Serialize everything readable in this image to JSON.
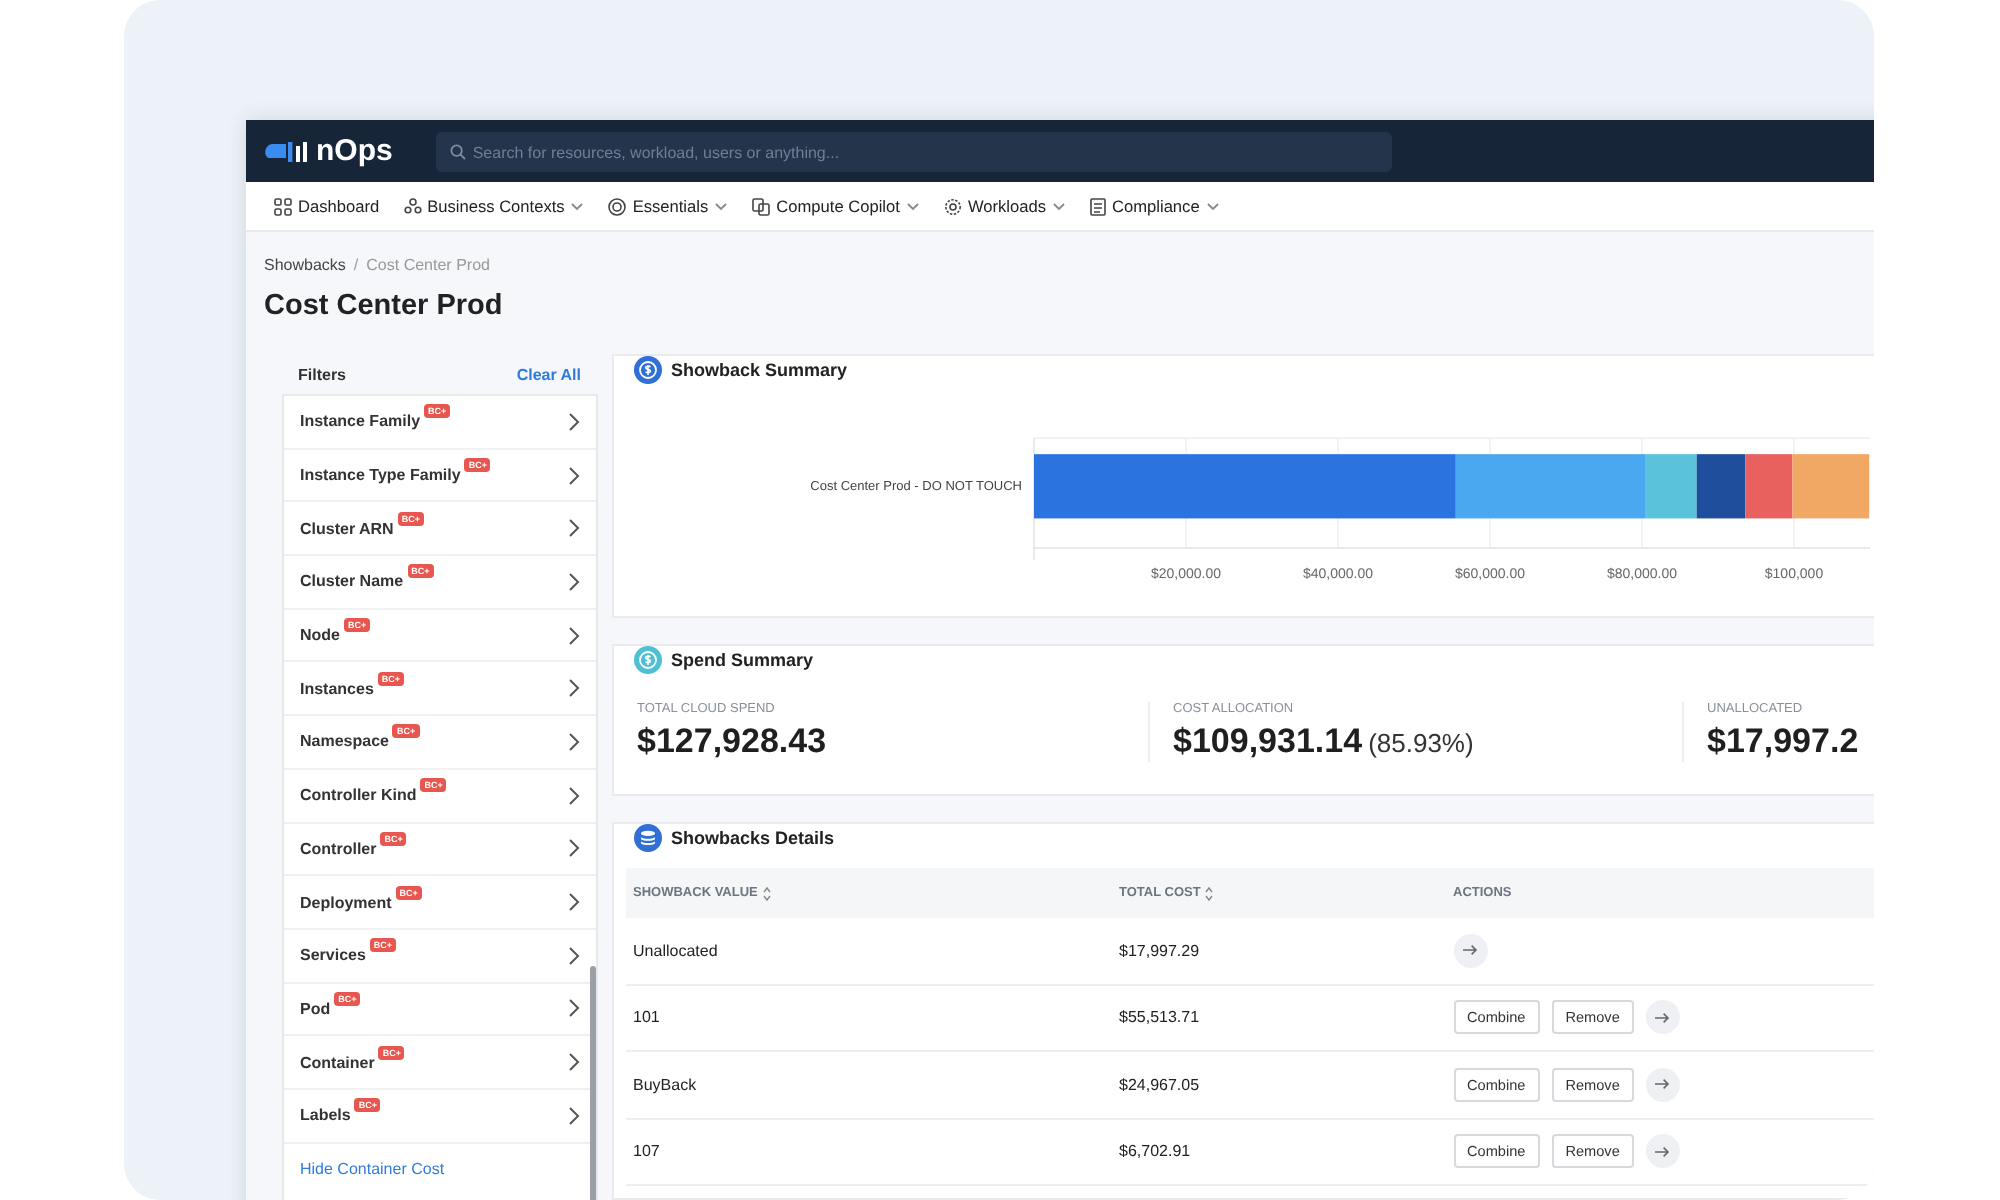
{
  "app": {
    "logo": "nOps",
    "search": {
      "placeholder": "Search for resources, workload, users or anything..."
    }
  },
  "menu": [
    {
      "label": "Dashboard",
      "dropdown": false
    },
    {
      "label": "Business Contexts",
      "dropdown": true
    },
    {
      "label": "Essentials",
      "dropdown": true
    },
    {
      "label": "Compute Copilot",
      "dropdown": true
    },
    {
      "label": "Workloads",
      "dropdown": true
    },
    {
      "label": "Compliance",
      "dropdown": true
    }
  ],
  "breadcrumb": [
    "Showbacks",
    "Cost Center Prod"
  ],
  "breadcrumb_separator": "/",
  "title": "Cost Center Prod",
  "filters": {
    "title": "Filters",
    "clear": "Clear All",
    "link": "Hide Container Cost",
    "items": [
      {
        "label": "Instance Family",
        "badge": "BC+"
      },
      {
        "label": "Instance Type Family",
        "badge": "BC+"
      },
      {
        "label": "Cluster ARN",
        "badge": "BC+"
      },
      {
        "label": "Cluster Name",
        "badge": "BC+"
      },
      {
        "label": "Node",
        "badge": "BC+"
      },
      {
        "label": "Instances",
        "badge": "BC+"
      },
      {
        "label": "Namespace",
        "badge": "BC+"
      },
      {
        "label": "Controller Kind",
        "badge": "BC+"
      },
      {
        "label": "Controller",
        "badge": "BC+"
      },
      {
        "label": "Deployment",
        "badge": "BC+"
      },
      {
        "label": "Services",
        "badge": "BC+"
      },
      {
        "label": "Pod",
        "badge": "BC+"
      },
      {
        "label": "Container",
        "badge": "BC+"
      },
      {
        "label": "Labels",
        "badge": "BC+"
      }
    ]
  },
  "showback_summary": {
    "title": "Showback Summary",
    "chart_data": {
      "type": "bar",
      "orientation": "horizontal",
      "stacked": true,
      "categories": [
        "Cost Center Prod - DO NOT TOUCH"
      ],
      "xlim": [
        0,
        110000
      ],
      "grid": true,
      "xticks": [
        {
          "value": 20000,
          "label": "$20,000.00"
        },
        {
          "value": 40000,
          "label": "$40,000.00"
        },
        {
          "value": 60000,
          "label": "$60,000.00"
        },
        {
          "value": 80000,
          "label": "$80,000.00"
        },
        {
          "value": 100000,
          "label": "$100,000"
        }
      ],
      "series": [
        {
          "color": "#2b74e0",
          "values": [
            55500
          ]
        },
        {
          "color": "#4aa8f0",
          "values": [
            25000
          ]
        },
        {
          "color": "#5bc2dc",
          "values": [
            6700
          ]
        },
        {
          "color": "#1f4f9c",
          "values": [
            6400
          ]
        },
        {
          "color": "#e8615f",
          "values": [
            6200
          ]
        },
        {
          "color": "#f2a865",
          "values": [
            10100
          ]
        }
      ]
    }
  },
  "spend_summary": {
    "title": "Spend Summary",
    "stats": [
      {
        "label": "TOTAL CLOUD SPEND",
        "value": "$127,928.43"
      },
      {
        "label": "COST ALLOCATION",
        "value": "$109,931.14",
        "note": "(85.93%)"
      },
      {
        "label": "UNALLOCATED",
        "value": "$17,997.2"
      }
    ]
  },
  "details": {
    "title": "Showbacks Details",
    "columns": [
      {
        "label": "SHOWBACK VALUE",
        "sortable": true
      },
      {
        "label": "TOTAL COST",
        "sortable": true
      },
      {
        "label": "ACTIONS",
        "sortable": false
      }
    ],
    "rows": [
      {
        "value": "Unallocated",
        "cost": "$17,997.29"
      },
      {
        "value": "101",
        "cost": "$55,513.71",
        "buttons": [
          "Combine",
          "Remove"
        ]
      },
      {
        "value": "BuyBack",
        "cost": "$24,967.05",
        "buttons": [
          "Combine",
          "Remove"
        ]
      },
      {
        "value": "107",
        "cost": "$6,702.91",
        "buttons": [
          "Combine",
          "Remove"
        ]
      }
    ]
  }
}
